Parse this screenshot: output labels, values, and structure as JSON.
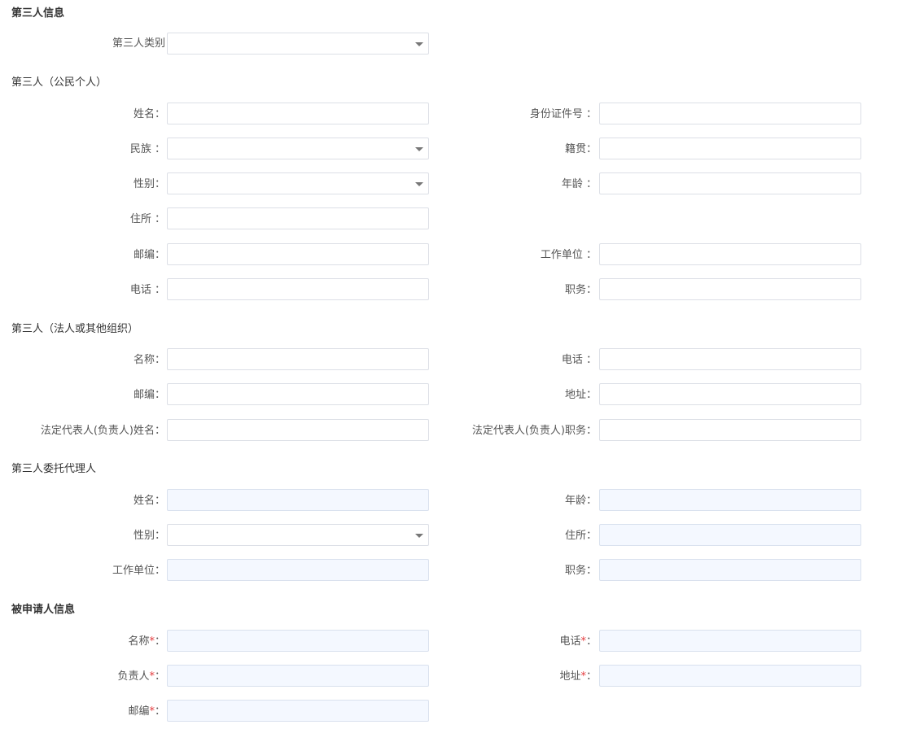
{
  "third_party_info": {
    "title": "第三人信息",
    "category_label": "第三人类别",
    "category_value": ""
  },
  "citizen": {
    "title": "第三人（公民个人）",
    "name_label": "姓名：",
    "id_label": "身份证件号 ：",
    "ethnicity_label": "民族 ：",
    "native_place_label": "籍贯：",
    "gender_label": "性别：",
    "age_label": "年龄 ：",
    "residence_label": "住所 ：",
    "postcode_label": "邮编：",
    "employer_label": "工作单位 ：",
    "phone_label": "电话 ：",
    "position_label": "职务："
  },
  "organization": {
    "title": "第三人（法人或其他组织）",
    "name_label": "名称：",
    "phone_label": "电话 ：",
    "postcode_label": "邮编：",
    "address_label": "地址：",
    "rep_name_label": "法定代表人(负责人)姓名：",
    "rep_position_label": "法定代表人(负责人)职务："
  },
  "agent": {
    "title": "第三人委托代理人",
    "name_label": "姓名：",
    "age_label": "年龄：",
    "gender_label": "性别：",
    "residence_label": "住所：",
    "employer_label": "工作单位：",
    "position_label": "职务："
  },
  "respondent": {
    "title": "被申请人信息",
    "name_label": "名称",
    "phone_label": "电话",
    "head_label": "负责人",
    "address_label": "地址",
    "postcode_label": "邮编",
    "required_mark": "*",
    "colon": "："
  }
}
